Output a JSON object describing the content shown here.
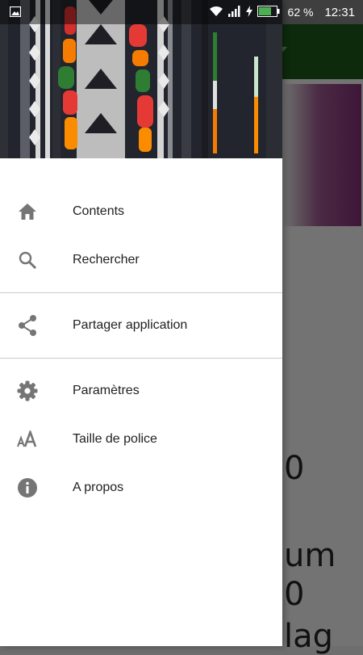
{
  "status_bar": {
    "battery_percent": "62 %",
    "time": "12:31"
  },
  "menu": {
    "items": [
      {
        "label": "Contents",
        "icon": "home-icon"
      },
      {
        "label": "Rechercher",
        "icon": "search-icon"
      },
      {
        "label": "Partager application",
        "icon": "share-icon"
      },
      {
        "label": "Paramètres",
        "icon": "settings-icon"
      },
      {
        "label": "Taille de police",
        "icon": "font-size-icon"
      },
      {
        "label": "A propos",
        "icon": "info-icon"
      }
    ]
  },
  "background_content": {
    "line1": "0",
    "line2": "um",
    "line3": "0",
    "line4": "lag"
  },
  "colors": {
    "toolbar": "#0d2a0d",
    "icon": "#757575",
    "scrim": "#737373"
  }
}
